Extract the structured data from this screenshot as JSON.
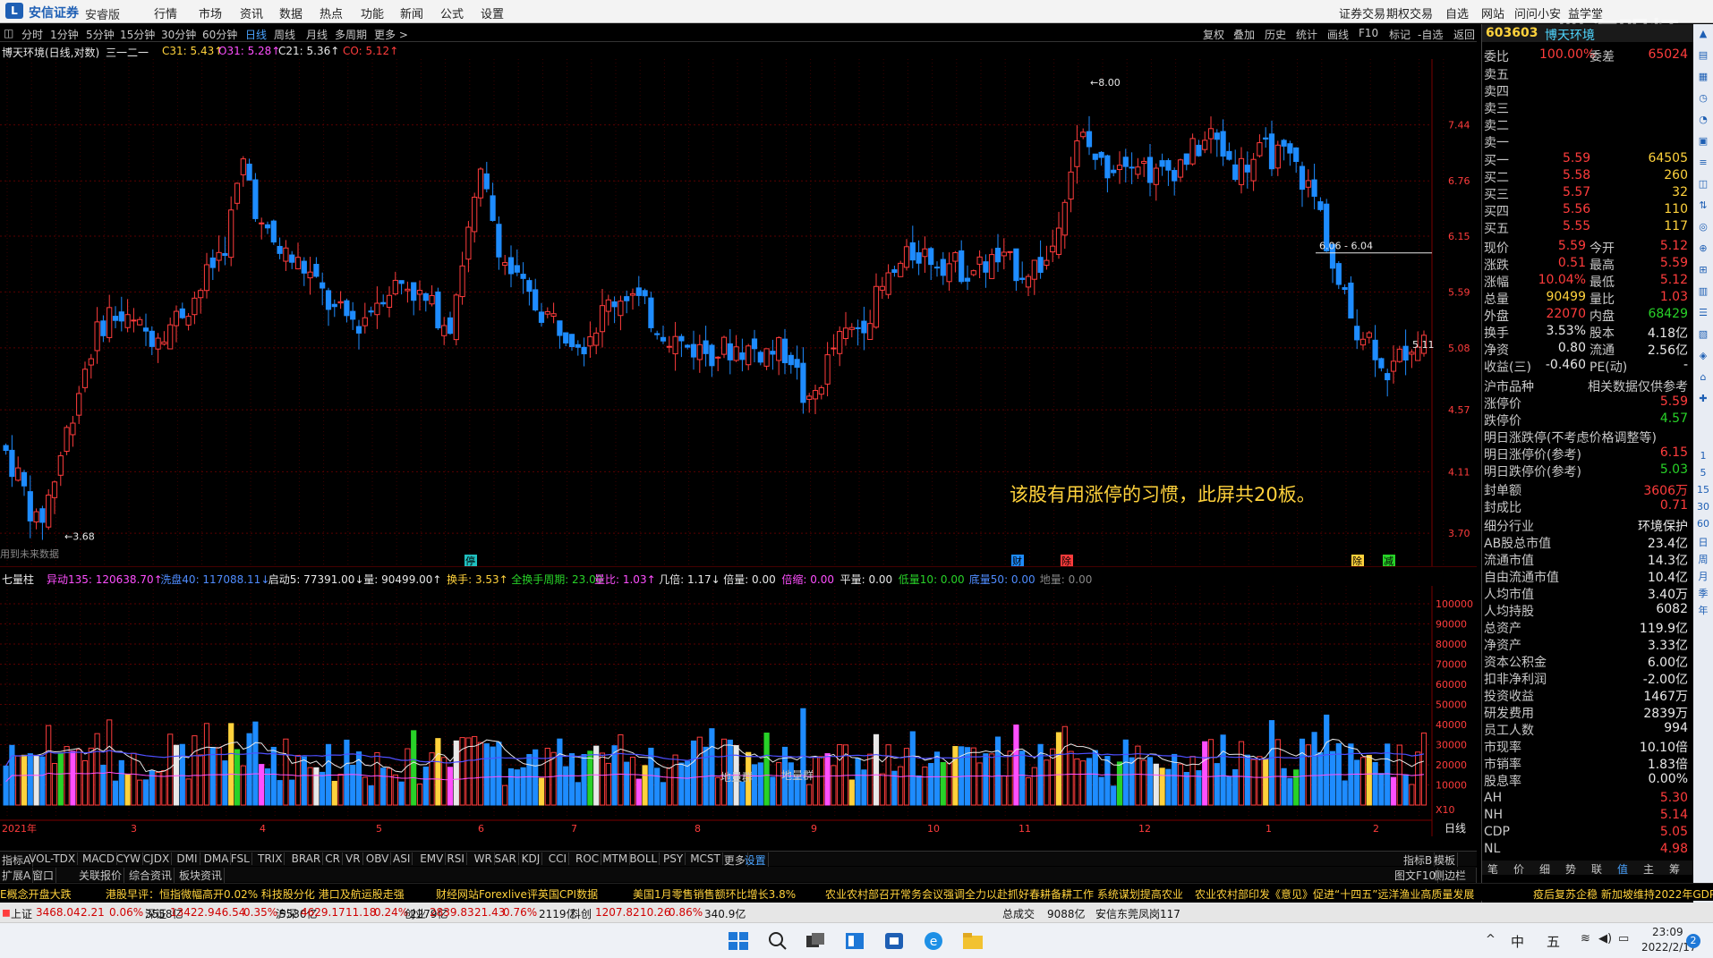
{
  "menubar": {
    "brand": "安信证券",
    "brand_sub": "安睿版",
    "items": [
      "行情",
      "市场",
      "资讯",
      "数据",
      "热点",
      "功能",
      "新闻",
      "公式",
      "设置"
    ],
    "right_items": [
      "证券交易",
      "期权交易",
      "自选",
      "网站",
      "问问小安",
      "益学堂"
    ]
  },
  "toolbar": {
    "periods": [
      "分时",
      "1分钟",
      "5分钟",
      "15分钟",
      "30分钟",
      "60分钟",
      "日线",
      "周线",
      "月线",
      "多周期",
      "更多 >"
    ],
    "active_period": "日线",
    "right": [
      "复权",
      "叠加",
      "历史",
      "统计",
      "画线",
      "F10",
      "标记",
      "-自选",
      "返回"
    ]
  },
  "chart_head": {
    "title": "博天环境(日线,对数)",
    "mode": "三一二一",
    "c31": "C31: 5.43↑",
    "o31": "O31: 5.28↑",
    "c21": "C21: 5.36↑",
    "co": "CO: 5.12↑"
  },
  "price_axis": [
    "7.44",
    "6.76",
    "6.15",
    "5.59",
    "5.08",
    "4.57",
    "4.11",
    "3.70"
  ],
  "annotations": {
    "high": "8.00",
    "low": "3.68",
    "range": "6.06 - 6.04",
    "last": "5.11",
    "note": "该股有用涨停的习惯，此屏共20板。",
    "left_note": "用到未来数据",
    "flags": [
      "停",
      "财",
      "除",
      "除",
      "减"
    ]
  },
  "vol_head": {
    "name": "七量柱",
    "items": [
      {
        "t": "异动135: 120638.70↑",
        "c": "#ff4fff"
      },
      {
        "t": "洗盘40: 117088.11↓",
        "c": "#4f8cff"
      },
      {
        "t": "启动5: 77391.00↓",
        "c": "#e8e8e8"
      },
      {
        "t": "量: 90499.00↑",
        "c": "#e8e8e8"
      },
      {
        "t": "换手: 3.53↑",
        "c": "#ffd23c"
      },
      {
        "t": "全换手周期: 23.00",
        "c": "#28d228"
      },
      {
        "t": "量比: 1.03↑",
        "c": "#ff4fff"
      },
      {
        "t": "几倍: 1.17↓",
        "c": "#e8e8e8"
      },
      {
        "t": "倍量: 0.00",
        "c": "#e8e8e8"
      },
      {
        "t": "倍缩: 0.00",
        "c": "#ff4fff"
      },
      {
        "t": "平量: 0.00",
        "c": "#e8e8e8"
      },
      {
        "t": "低量10: 0.00",
        "c": "#28d228"
      },
      {
        "t": "底量50: 0.00",
        "c": "#4f8cff"
      },
      {
        "t": "地量: 0.00",
        "c": "#888888"
      }
    ],
    "labels": [
      "地量群",
      "地量群"
    ]
  },
  "vol_axis": [
    "100000",
    "90000",
    "80000",
    "70000",
    "60000",
    "50000",
    "40000",
    "30000",
    "20000",
    "10000"
  ],
  "vol_unit": "X10",
  "date_axis": [
    "2021年",
    "3",
    "4",
    "5",
    "6",
    "7",
    "8",
    "9",
    "10",
    "11",
    "12",
    "1",
    "2"
  ],
  "date_mode": "日线",
  "quote": {
    "code": "603603",
    "name": "博天环境",
    "webi_label": "委比",
    "webi": "100.00%",
    "weicha_label": "委差",
    "weicha": "65024",
    "sells": [
      "卖五",
      "卖四",
      "卖三",
      "卖二",
      "卖一"
    ],
    "buys": [
      {
        "l": "买一",
        "p": "5.59",
        "v": "64505"
      },
      {
        "l": "买二",
        "p": "5.58",
        "v": "260"
      },
      {
        "l": "买三",
        "p": "5.57",
        "v": "32"
      },
      {
        "l": "买四",
        "p": "5.56",
        "v": "110"
      },
      {
        "l": "买五",
        "p": "5.55",
        "v": "117"
      }
    ],
    "stats": [
      {
        "l": "现价",
        "v": "5.59",
        "c": "red",
        "l2": "今开",
        "v2": "5.12",
        "c2": "red"
      },
      {
        "l": "涨跌",
        "v": "0.51",
        "c": "red",
        "l2": "最高",
        "v2": "5.59",
        "c2": "red"
      },
      {
        "l": "涨幅",
        "v": "10.04%",
        "c": "red",
        "l2": "最低",
        "v2": "5.12",
        "c2": "red"
      },
      {
        "l": "总量",
        "v": "90499",
        "c": "yellow",
        "l2": "量比",
        "v2": "1.03",
        "c2": "red"
      },
      {
        "l": "外盘",
        "v": "22070",
        "c": "red",
        "l2": "内盘",
        "v2": "68429",
        "c2": "green"
      },
      {
        "l": "换手",
        "v": "3.53%",
        "c": "white",
        "l2": "股本",
        "v2": "4.18亿",
        "c2": "white"
      },
      {
        "l": "净资",
        "v": "0.80",
        "c": "white",
        "l2": "流通",
        "v2": "2.56亿",
        "c2": "white"
      },
      {
        "l": "收益(三)",
        "v": "-0.460",
        "c": "white",
        "l2": "PE(动)",
        "v2": "-",
        "c2": "white"
      }
    ],
    "market_row": {
      "l": "沪市品种",
      "r": "相关数据仅供参考"
    },
    "limits": [
      {
        "l": "涨停价",
        "v": "5.59",
        "c": "red"
      },
      {
        "l": "跌停价",
        "v": "4.57",
        "c": "green"
      }
    ],
    "next_title": "明日涨跌停(不考虑价格调整等)",
    "next": [
      {
        "l": "明日涨停价(参考)",
        "v": "6.15",
        "c": "red"
      },
      {
        "l": "明日跌停价(参考)",
        "v": "5.03",
        "c": "green"
      }
    ],
    "seal": [
      {
        "l": "封单额",
        "v": "3606万",
        "c": "red"
      },
      {
        "l": "封成比",
        "v": "0.71",
        "c": "red"
      }
    ],
    "fundamentals": [
      {
        "l": "细分行业",
        "v": "环境保护"
      },
      {
        "l": "AB股总市值",
        "v": "23.4亿"
      },
      {
        "l": "流通市值",
        "v": "14.3亿"
      },
      {
        "l": "自由流通市值",
        "v": "10.4亿"
      },
      {
        "l": "人均市值",
        "v": "3.40万"
      },
      {
        "l": "人均持股",
        "v": "6082"
      },
      {
        "l": "总资产",
        "v": "119.9亿"
      },
      {
        "l": "净资产",
        "v": "3.33亿"
      },
      {
        "l": "资本公积金",
        "v": "6.00亿"
      },
      {
        "l": "扣非净利润",
        "v": "-2.00亿"
      },
      {
        "l": "投资收益",
        "v": "1467万"
      },
      {
        "l": "研发费用",
        "v": "2839万"
      },
      {
        "l": "员工人数",
        "v": "994"
      },
      {
        "l": "市现率",
        "v": "10.10倍"
      },
      {
        "l": "市销率",
        "v": "1.83倍"
      },
      {
        "l": "股息率",
        "v": "0.00%"
      }
    ],
    "ah": [
      {
        "l": "AH",
        "v": "5.30"
      },
      {
        "l": "NH",
        "v": "5.14"
      },
      {
        "l": "CDP",
        "v": "5.05"
      },
      {
        "l": "NL",
        "v": "4.98"
      }
    ],
    "bottom_tabs": [
      "笔",
      "价",
      "细",
      "势",
      "联",
      "值",
      "主",
      "筹"
    ]
  },
  "indicator_tabs": [
    "指标A",
    "VOL-TDX",
    "MACD",
    "CYW",
    "CJDX",
    "DMI",
    "DMA",
    "FSL",
    "TRIX",
    "BRAR",
    "CR",
    "VR",
    "OBV",
    "ASI",
    "EMV",
    "RSI",
    "WR",
    "SAR",
    "KDJ",
    "CCI",
    "ROC",
    "MTM",
    "BOLL",
    "PSY",
    "MCST",
    "更多",
    "设置"
  ],
  "indicator_right": [
    "指标B",
    "模板"
  ],
  "window_tabs": [
    "窗口",
    "扩展A",
    "关联报价",
    "综合资讯",
    "板块资讯"
  ],
  "window_right": [
    "图文F10",
    "侧边栏 «"
  ],
  "ticker": [
    "E概念开盘大跌",
    "港股早评：恒指微幅高开0.02% 科技股分化 港口及航运股走强",
    "财经网站Forexlive评英国CPI数据",
    "美国1月零售销售额环比增长3.8%",
    "农业农村部召开常务会议强调全力以赴抓好春耕备耕工作 系统谋划提高农业",
    "农业农村部印发《意见》促进“十四五”远洋渔业高质量发展",
    "疫后复苏企稳 新加坡维持2022年GDP"
  ],
  "indexbar": [
    {
      "n": "上证",
      "v": "3468.04",
      "c": "2.21",
      "p": "0.06%",
      "a": "3558亿"
    },
    {
      "n": "深证",
      "v": "13422.9",
      "c": "46.54",
      "p": "0.35%",
      "a": "5530亿"
    },
    {
      "n": "沪深",
      "v": "4629.17",
      "c": "11.18",
      "p": "0.24%",
      "a": "2279亿"
    },
    {
      "n": "创业",
      "v": "2839.83",
      "c": "21.43",
      "p": "0.76%",
      "a": "2119亿"
    },
    {
      "n": "科创",
      "v": "1207.82",
      "c": "10.26",
      "p": "0.86%",
      "a": "340.9亿"
    }
  ],
  "indexbar_total_label": "总成交",
  "indexbar_total": "9088亿",
  "indexbar_broker": "安信东莞凤岗117",
  "taskbar": {
    "ime1": "中",
    "ime2": "五",
    "time": "23:09",
    "date": "2022/2/17",
    "badge": "2"
  },
  "watermark": "股海明灯",
  "side_labels": [
    "1",
    "5",
    "15",
    "30",
    "60",
    "日",
    "周",
    "月",
    "季",
    "年"
  ],
  "colors": {
    "up": "#ff3c3c",
    "down": "#1e8cff",
    "bg": "#000000",
    "grid": "#5a0000"
  },
  "chart_data": {
    "type": "candlestick",
    "title": "博天环境(日线,对数)",
    "scale": "log",
    "ylim": [
      3.68,
      8.0
    ],
    "candles_sample": [
      {
        "o": 4.2,
        "h": 4.28,
        "l": 4.1,
        "c": 4.16
      },
      {
        "o": 4.05,
        "h": 4.1,
        "l": 3.68,
        "c": 3.8
      },
      {
        "o": 4.2,
        "h": 4.6,
        "l": 4.15,
        "c": 4.55
      },
      {
        "o": 5.1,
        "h": 5.9,
        "l": 5.0,
        "c": 5.8
      },
      {
        "o": 6.2,
        "h": 7.5,
        "l": 6.0,
        "c": 7.2
      },
      {
        "o": 6.7,
        "h": 6.8,
        "l": 6.0,
        "c": 6.1
      },
      {
        "o": 5.6,
        "h": 5.7,
        "l": 5.1,
        "c": 5.2
      },
      {
        "o": 6.8,
        "h": 7.0,
        "l": 6.2,
        "c": 6.3
      },
      {
        "o": 5.6,
        "h": 5.7,
        "l": 5.3,
        "c": 5.35
      },
      {
        "o": 5.2,
        "h": 5.3,
        "l": 5.05,
        "c": 5.1
      },
      {
        "o": 5.0,
        "h": 5.1,
        "l": 4.45,
        "c": 4.55
      },
      {
        "o": 5.8,
        "h": 6.3,
        "l": 5.7,
        "c": 6.2
      },
      {
        "o": 7.0,
        "h": 8.0,
        "l": 6.9,
        "c": 7.4
      },
      {
        "o": 7.2,
        "h": 7.3,
        "l": 6.7,
        "c": 6.8
      },
      {
        "o": 6.1,
        "h": 6.2,
        "l": 5.5,
        "c": 5.6
      },
      {
        "o": 5.2,
        "h": 5.4,
        "l": 4.8,
        "c": 4.95
      },
      {
        "o": 5.12,
        "h": 5.59,
        "l": 5.12,
        "c": 5.59
      }
    ],
    "volume_ylim": [
      0,
      100000
    ]
  }
}
